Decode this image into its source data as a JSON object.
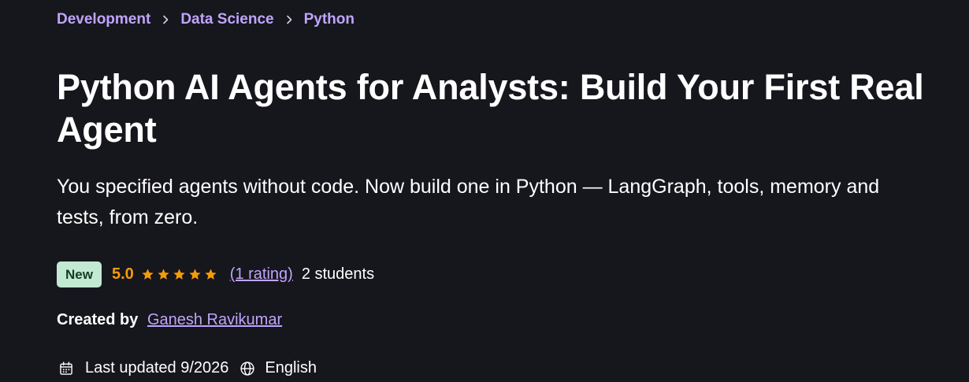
{
  "breadcrumb": {
    "items": [
      "Development",
      "Data Science",
      "Python"
    ]
  },
  "course": {
    "title": "Python AI Agents for Analysts: Build Your First Real Agent",
    "subtitle": "You specified agents without code. Now build one in Python — LangGraph, tools, memory and tests, from zero.",
    "badge": "New",
    "rating_value": "5.0",
    "stars": 5,
    "rating_count": "(1 rating)",
    "students": "2 students",
    "created_by_label": "Created by",
    "instructor": "Ganesh Ravikumar",
    "last_updated": "Last updated 9/2026",
    "language": "English"
  },
  "colors": {
    "background": "#16161d",
    "link": "#c0a4fc",
    "rating": "#f69c08",
    "badge_bg": "#c2e9d1",
    "badge_text": "#123d25"
  },
  "icons": {
    "separator": "chevron-right-icon",
    "star": "star-icon",
    "calendar": "calendar-icon",
    "language": "globe-icon"
  }
}
